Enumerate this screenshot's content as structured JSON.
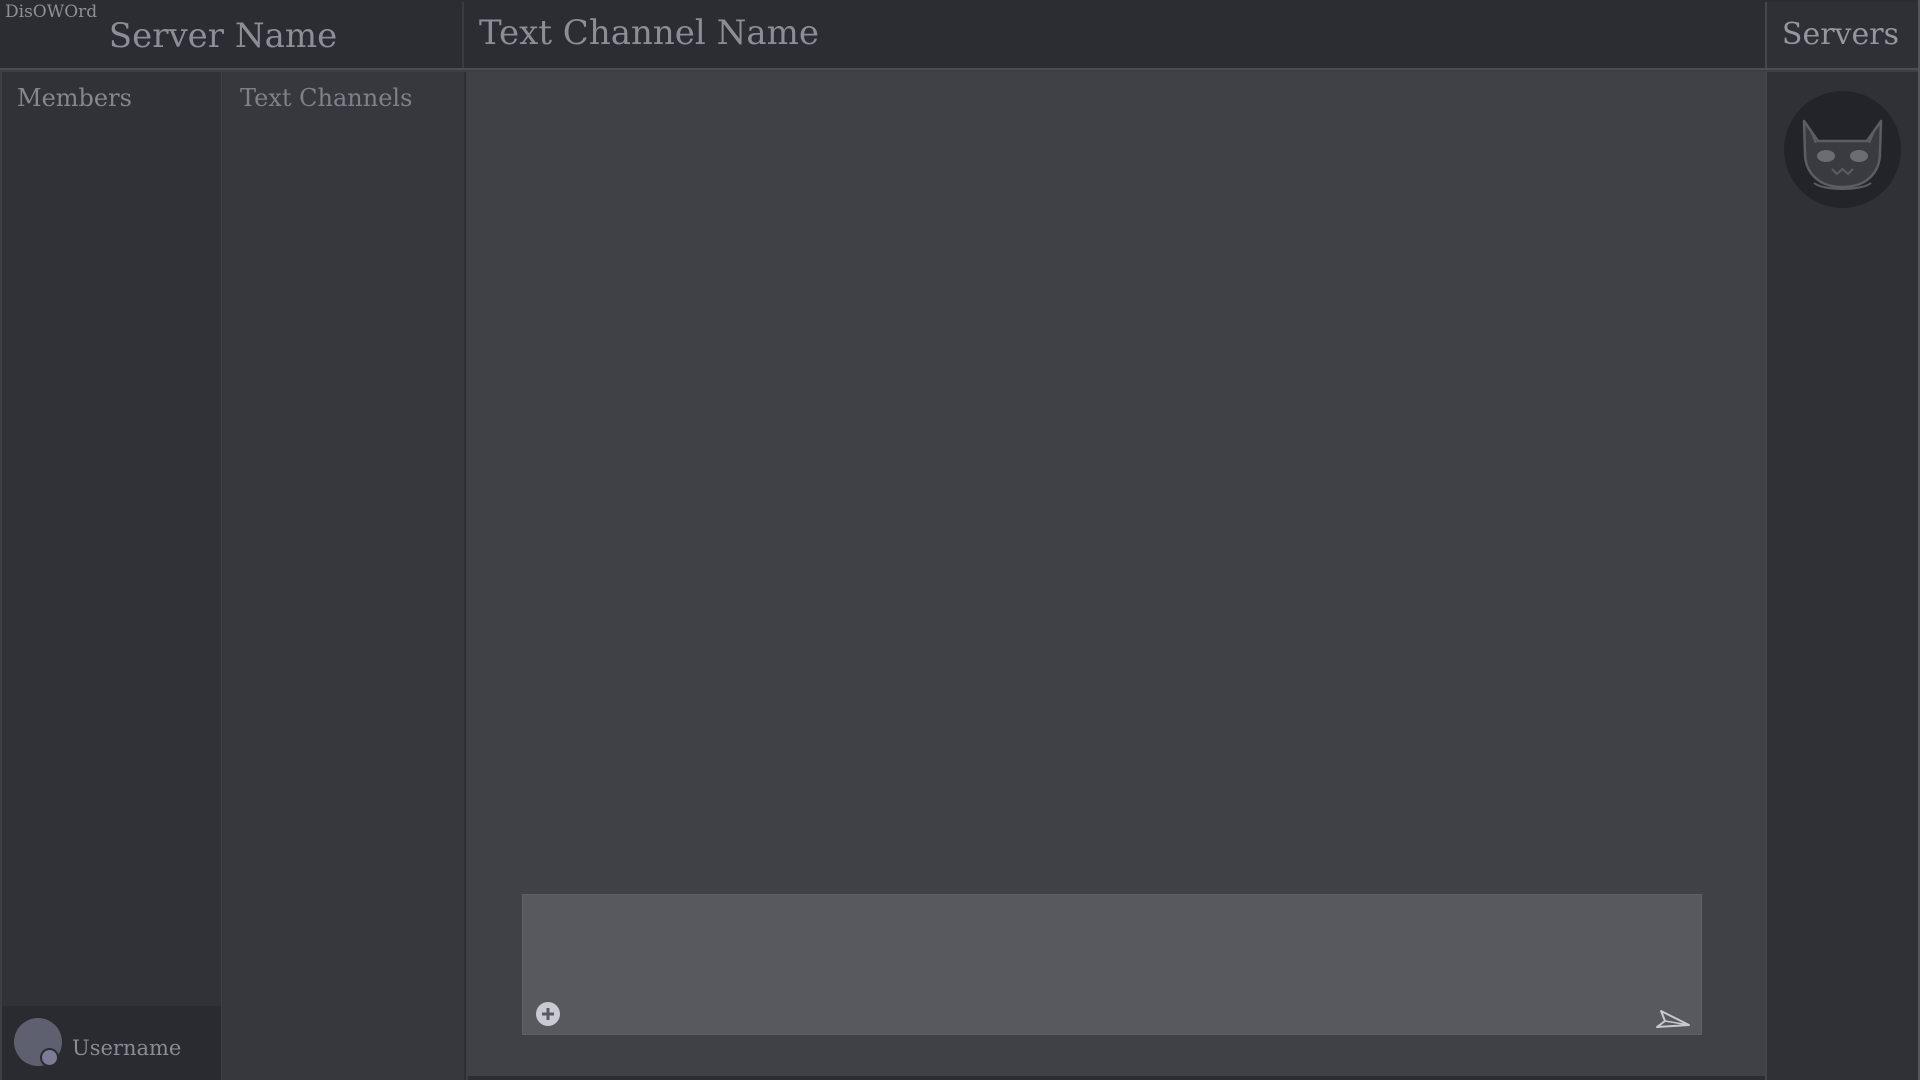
{
  "app": {
    "title": "DisOWOrd"
  },
  "header": {
    "server_name": "Server Name",
    "channel_name": "Text Channel Name",
    "servers_label": "Servers"
  },
  "members": {
    "title": "Members"
  },
  "channels": {
    "title": "Text Channels"
  },
  "user": {
    "username": "Username"
  },
  "composer": {
    "value": "",
    "add_icon": "plus-circle-icon",
    "send_icon": "paper-plane-icon"
  },
  "servers": {
    "items": [
      {
        "icon": "cat-face-icon"
      }
    ]
  },
  "colors": {
    "background": "#404146",
    "header": "#2c2d32",
    "sidebar": "#313237",
    "channels": "#37383e",
    "composer": "#58595e",
    "text": "#8c8d97",
    "status": "#7a7d95"
  }
}
